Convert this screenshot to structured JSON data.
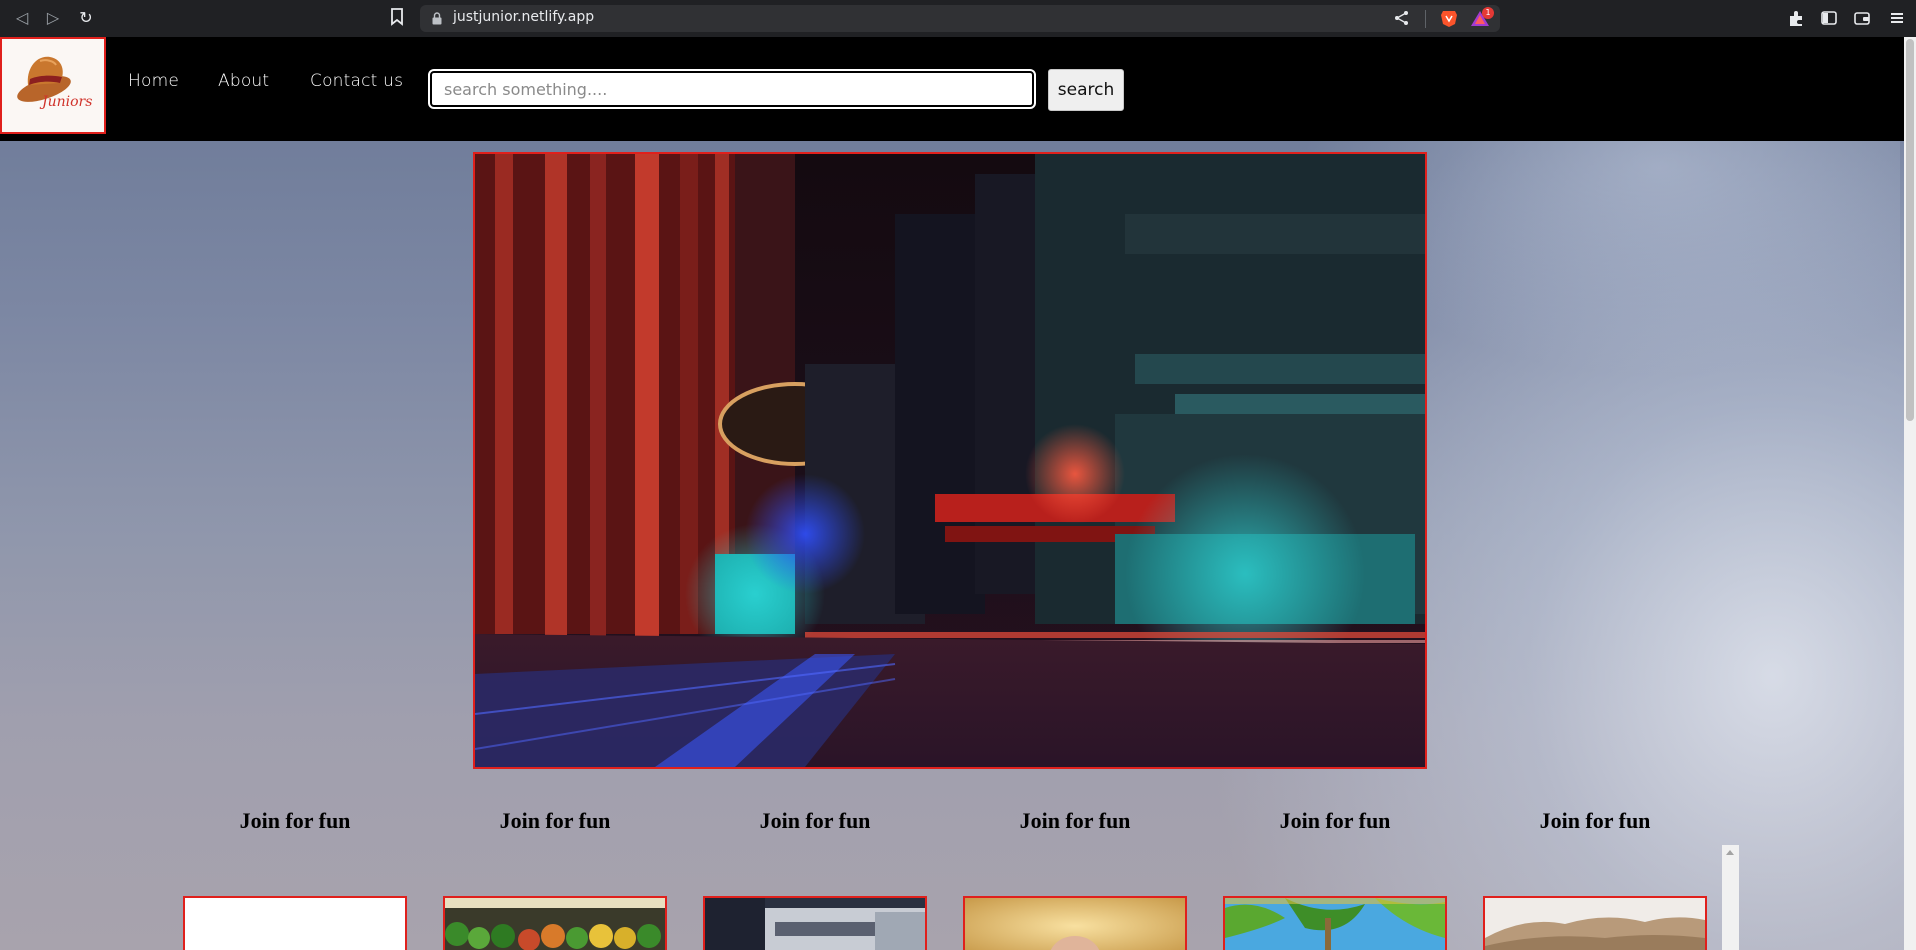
{
  "browser": {
    "url": "justjunior.netlify.app",
    "rewards_badge": "1"
  },
  "site": {
    "logo_text": "Juniors",
    "nav": {
      "home": "Home",
      "about": "About",
      "contact": "Contact us"
    },
    "search": {
      "placeholder": "search something....",
      "button_label": "search"
    }
  },
  "cards": [
    {
      "title": "Join for fun"
    },
    {
      "title": "Join for fun"
    },
    {
      "title": "Join for fun"
    },
    {
      "title": "Join for fun"
    },
    {
      "title": "Join for fun"
    },
    {
      "title": "Join for fun"
    }
  ],
  "colors": {
    "accent_border": "#e0201c",
    "header_bg": "#000000"
  }
}
